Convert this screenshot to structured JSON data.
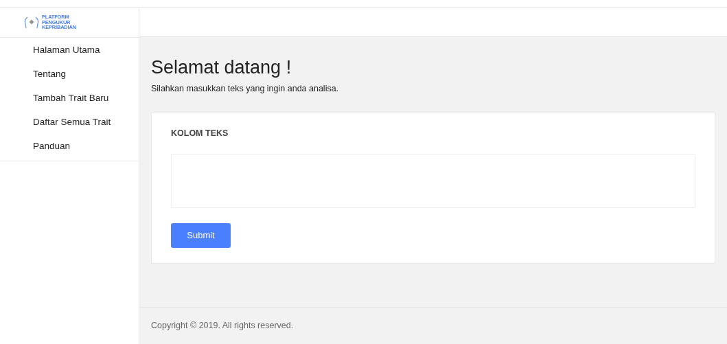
{
  "logo": {
    "lines": [
      "PLATFORM",
      "PENGUKUR",
      "KEPRIBADIAN"
    ]
  },
  "sidebar": {
    "items": [
      {
        "label": "Halaman Utama"
      },
      {
        "label": "Tentang"
      },
      {
        "label": "Tambah Trait Baru"
      },
      {
        "label": "Daftar Semua Trait"
      },
      {
        "label": "Panduan"
      }
    ]
  },
  "main": {
    "title": "Selamat datang !",
    "subtitle": "Silahkan masukkan teks yang ingin anda analisa.",
    "card": {
      "label": "KOLOM TEKS",
      "button": "Submit"
    }
  },
  "footer": {
    "text": "Copyright © 2019. All rights reserved."
  }
}
